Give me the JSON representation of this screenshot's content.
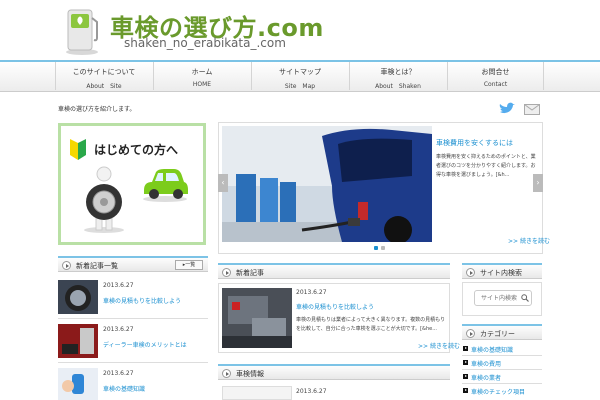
{
  "header": {
    "title": "車検の選び方.com",
    "subtitle": "shaken_no_erabikata_.com"
  },
  "nav": [
    {
      "jp": "このサイトについて",
      "en": "About　Site"
    },
    {
      "jp": "ホーム",
      "en": "HOME"
    },
    {
      "jp": "サイトマップ",
      "en": "Site　Map"
    },
    {
      "jp": "車検とは？",
      "en": "About　Shaken"
    },
    {
      "jp": "お問合せ",
      "en": "Contact"
    }
  ],
  "tagline": "車検の選び方を紹介します。",
  "banner": {
    "text": "はじめての方へ"
  },
  "slider": {
    "title": "車検費用を安くするには",
    "description": "車検費用を安く抑えるためのポイントと、業者選びのコツを分かりやすく紹介します。お得な車検を選びましょう。[&h...",
    "more": ">> 続きを読む"
  },
  "left_widget": {
    "title": "新着記事一覧",
    "list_button": "▸一覧",
    "items": [
      {
        "date": "2013.6.27",
        "title": "車検の見積もりを比較しよう"
      },
      {
        "date": "2013.6.27",
        "title": "ディーラー車検のメリットとは"
      },
      {
        "date": "2013.6.27",
        "title": "車検の基礎知識"
      }
    ]
  },
  "main_section": {
    "title": "新着記事",
    "post": {
      "date": "2013.6.27",
      "title": "車検の見積もりを比較しよう",
      "description": "車検の見積もりは業者によって大きく異なります。複数の見積もりを比較して、自分に合った車検を選ぶことが大切です。[&he...",
      "more": ">> 続きを読む"
    },
    "second_title": "車検情報",
    "second_date": "2013.6.27"
  },
  "right_widgets": {
    "search_title": "サイト内検索",
    "search_placeholder": "サイト内検索",
    "category_title": "カテゴリー",
    "categories": [
      "車検の基礎知識",
      "車検の費用",
      "車検の業者",
      "車検のチェック項目"
    ]
  },
  "colors": {
    "accent": "#7cc3e6",
    "link": "#1a8fd0",
    "brand": "#6a9a2c"
  }
}
